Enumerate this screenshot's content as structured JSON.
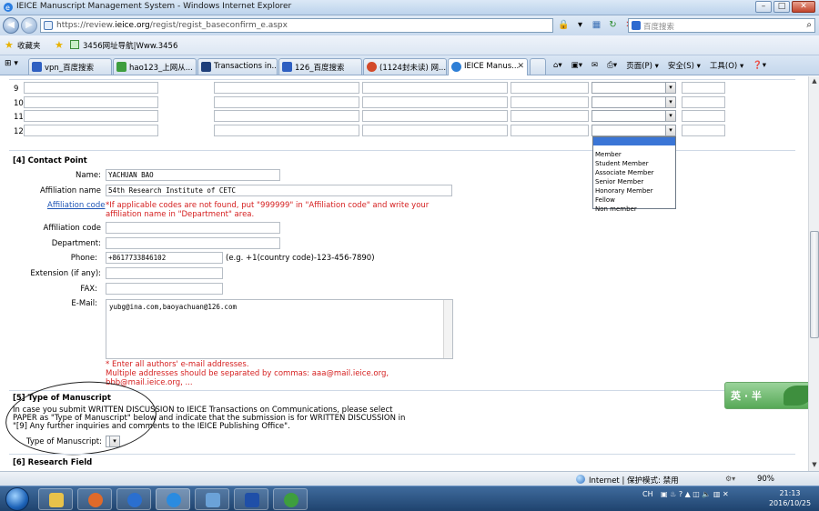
{
  "window": {
    "title": "IEICE Manuscript Management System - Windows Internet Explorer"
  },
  "address": {
    "url_prefix": "https://review.",
    "url_domain": "ieice.org",
    "url_rest": "/regist/regist_baseconfirm_e.aspx"
  },
  "search": {
    "placeholder": "百度搜索"
  },
  "favorites": {
    "label": "收藏夹",
    "items": [
      "3456网址导航|Www.3456"
    ]
  },
  "tabs": [
    {
      "label": "vpn_百度搜索",
      "color": "#2e5fc1"
    },
    {
      "label": "hao123_上网从...",
      "color": "#3e9e3e"
    },
    {
      "label": "Transactions in...",
      "color": "#1f3f7a"
    },
    {
      "label": "126_百度搜索",
      "color": "#2e5fc1"
    },
    {
      "label": "(1124封未读) 网...",
      "color": "#d34a2a"
    },
    {
      "label": "IEICE Manus...",
      "color": "#2e7fd6"
    }
  ],
  "command_bar": {
    "page": "页面(P) ▾",
    "safety": "安全(S) ▾",
    "tools": "工具(O) ▾",
    "help": "❓▾"
  },
  "coauthor_rows": [
    "9",
    "10",
    "11",
    "12"
  ],
  "member_type_options": [
    "Member",
    "Student Member",
    "Associate Member",
    "Senior Member",
    "Honorary Member",
    "Fellow",
    "Non member"
  ],
  "contact": {
    "section_title": "[4] Contact Point",
    "name_label": "Name:",
    "name_value": "YACHUAN BAO",
    "affiliation_name_label": "Affiliation name",
    "affiliation_name_value": "54th Research Institute of CETC",
    "affiliation_code_link": "Affiliation code",
    "affiliation_note_1": "*If applicable codes are not found, put \"999999\" in \"Affiliation code\" and write your",
    "affiliation_note_2": "affiliation name in \"Department\" area.",
    "affiliation_code_label": "Affiliation code",
    "department_label": "Department:",
    "phone_label": "Phone:",
    "phone_value": "+8617733846102",
    "phone_hint": "(e.g. +1(country code)-123-456-7890)",
    "extension_label": "Extension (if any):",
    "fax_label": "FAX:",
    "email_label": "E-Mail:",
    "email_value": "yubg@ina.com,baoyachuan@126.com",
    "email_note_1": "* Enter all authors' e-mail addresses.",
    "email_note_2": "Multiple addresses should be separated by commas: aaa@mail.ieice.org,",
    "email_note_3": "bbb@mail.ieice.org, ..."
  },
  "manuscript": {
    "section_title": "[5] Type of Manuscript",
    "text_1": "In case you submit WRITTEN DISCUSSION to IEICE Transactions on Communications, please select",
    "text_2": "PAPER as \"Type of Manuscript\" below and indicate that the submission is for WRITTEN DISCUSSION in",
    "text_3": "\"[9] Any further inquiries and comments to the IEICE Publishing Office\".",
    "type_label": "Type of Manuscript:",
    "type_value": ""
  },
  "research": {
    "section_title": "[6] Research Field"
  },
  "ime": {
    "label": "英 · 半"
  },
  "status": {
    "zone": "Internet | 保护模式: 禁用",
    "zoom": "90%"
  },
  "taskbar": {
    "tray": "CH",
    "time": "21:13",
    "date": "2016/10/25"
  }
}
